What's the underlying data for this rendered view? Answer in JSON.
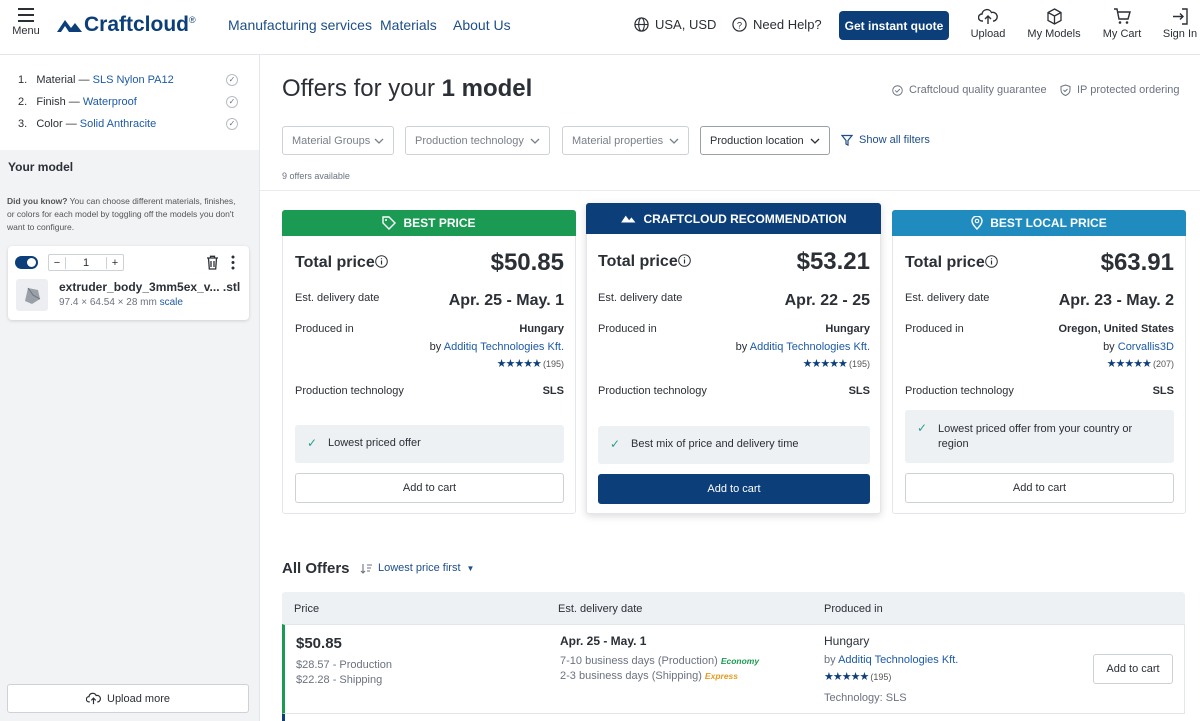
{
  "header": {
    "menu_label": "Menu",
    "logo_text": "Craftcloud",
    "logo_reg": "®",
    "nav": [
      "Manufacturing services",
      "Materials",
      "About Us"
    ],
    "region": "USA, USD",
    "help": "Need Help?",
    "cta": "Get instant quote",
    "actions": [
      "Upload",
      "My Models",
      "My Cart",
      "Sign In"
    ]
  },
  "sidebar": {
    "steps": [
      {
        "num": "1.",
        "key": "Material —",
        "value": "SLS Nylon PA12"
      },
      {
        "num": "2.",
        "key": "Finish —",
        "value": "Waterproof"
      },
      {
        "num": "3.",
        "key": "Color —",
        "value": "Solid Anthracite"
      }
    ],
    "your_model": "Your model",
    "tip_bold": "Did you know?",
    "tip_text": " You can choose different materials, finishes, or colors for each model by toggling off the models you don't want to configure.",
    "model": {
      "quantity": "1",
      "filename": "extruder_body_3mm5ex_v... .stl",
      "dimensions": "97.4 × 64.54 × 28 mm",
      "scale": "scale"
    },
    "upload_more": "Upload more"
  },
  "main": {
    "title_prefix": "Offers for your ",
    "title_bold": "1 model",
    "guarantees": [
      "Craftcloud quality guarantee",
      "IP protected ordering"
    ],
    "filters": [
      "Material Groups",
      "Production technology",
      "Material properties",
      "Production location"
    ],
    "show_filters": "Show all filters",
    "offers_count": "9 offers available",
    "offers": [
      {
        "badge": "BEST PRICE",
        "badge_color": "#1a9a52",
        "total_label": "Total price",
        "price": "$50.85",
        "delivery_label": "Est. delivery date",
        "delivery": "Apr. 25 - May. 1",
        "produced_label": "Produced in",
        "location": "Hungary",
        "by": "by ",
        "vendor": "Additiq Technologies Kft.",
        "stars": "★★★★★",
        "reviews": "(195)",
        "tech_label": "Production technology",
        "tech": "SLS",
        "note": "Lowest priced offer",
        "button": "Add to cart"
      },
      {
        "badge": "CRAFTCLOUD RECOMMENDATION",
        "badge_color": "#0c3f7a",
        "total_label": "Total price",
        "price": "$53.21",
        "delivery_label": "Est. delivery date",
        "delivery": "Apr. 22 - 25",
        "produced_label": "Produced in",
        "location": "Hungary",
        "by": "by ",
        "vendor": "Additiq Technologies Kft.",
        "stars": "★★★★★",
        "reviews": "(195)",
        "tech_label": "Production technology",
        "tech": "SLS",
        "note": "Best mix of price and delivery time",
        "button": "Add to cart"
      },
      {
        "badge": "BEST LOCAL PRICE",
        "badge_color": "#1f8bbf",
        "total_label": "Total price",
        "price": "$63.91",
        "delivery_label": "Est. delivery date",
        "delivery": "Apr. 23 - May. 2",
        "produced_label": "Produced in",
        "location": "Oregon, United States",
        "by": "by ",
        "vendor": "Corvallis3D",
        "stars": "★★★★★",
        "reviews": "(207)",
        "tech_label": "Production technology",
        "tech": "SLS",
        "note": "Lowest priced offer from your country or region",
        "button": "Add to cart"
      }
    ],
    "all_offers": {
      "title": "All Offers",
      "sort": "Lowest price first",
      "columns": [
        "Price",
        "Est. delivery date",
        "Produced in"
      ],
      "rows": [
        {
          "price": "$50.85",
          "production_cost": "$28.57 - Production",
          "shipping_cost": "$22.28 - Shipping",
          "delivery": "Apr. 25 - May. 1",
          "production_days": "7-10 business days (Production)",
          "production_speed": "Economy",
          "shipping_days": "2-3 business days (Shipping)",
          "shipping_speed": "Express",
          "location": "Hungary",
          "by": "by ",
          "vendor": "Additiq Technologies Kft.",
          "stars": "★★★★★",
          "reviews": "(195)",
          "technology": "Technology: SLS",
          "button": "Add to cart"
        }
      ]
    }
  },
  "colors": {
    "brand": "#0c3f7a",
    "link": "#1d5aa6",
    "green": "#1a9a52",
    "blue_badge": "#1f8bbf",
    "economy": "#1a9a52",
    "express": "#e39b1f"
  }
}
